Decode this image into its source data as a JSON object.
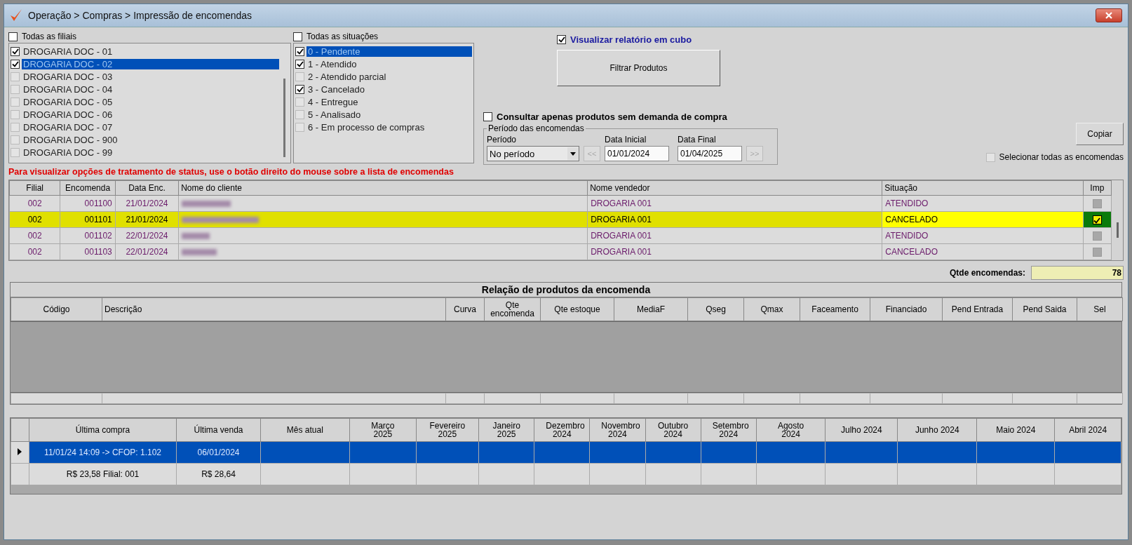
{
  "window": {
    "title": "Operação > Compras > Impressão de encomendas"
  },
  "branches": {
    "all_label": "Todas as filiais",
    "all_checked": false,
    "items": [
      {
        "label": "DROGARIA DOC - 01",
        "checked": true,
        "selected": false
      },
      {
        "label": "DROGARIA DOC - 02",
        "checked": true,
        "selected": true
      },
      {
        "label": "DROGARIA DOC - 03",
        "checked": false,
        "selected": false
      },
      {
        "label": "DROGARIA DOC - 04",
        "checked": false,
        "selected": false
      },
      {
        "label": "DROGARIA DOC - 05",
        "checked": false,
        "selected": false
      },
      {
        "label": "DROGARIA DOC - 06",
        "checked": false,
        "selected": false
      },
      {
        "label": "DROGARIA DOC - 07",
        "checked": false,
        "selected": false
      },
      {
        "label": "DROGARIA DOC - 900",
        "checked": false,
        "selected": false
      },
      {
        "label": "DROGARIA DOC - 99",
        "checked": false,
        "selected": false
      }
    ]
  },
  "situations": {
    "all_label": "Todas as situações",
    "all_checked": false,
    "items": [
      {
        "label": "0 - Pendente",
        "checked": true,
        "selected": true
      },
      {
        "label": "1 - Atendido",
        "checked": true,
        "selected": false
      },
      {
        "label": "2 - Atendido parcial",
        "checked": false,
        "selected": false
      },
      {
        "label": "3 - Cancelado",
        "checked": true,
        "selected": false
      },
      {
        "label": "4 - Entregue",
        "checked": false,
        "selected": false
      },
      {
        "label": "5 - Analisado",
        "checked": false,
        "selected": false
      },
      {
        "label": "6 - Em processo de compras",
        "checked": false,
        "selected": false
      }
    ]
  },
  "cube_option": {
    "label": "Visualizar relatório em cubo",
    "checked": true
  },
  "filter_button": "Filtrar Produtos",
  "no_demand_option": {
    "label": "Consultar apenas produtos sem demanda de compra",
    "checked": false
  },
  "period_group": {
    "title": "Período das encomendas",
    "period_label": "Período",
    "period_value": "No período",
    "prev_button": "<<",
    "start_label": "Data Inicial",
    "start_value": "01/01/2024",
    "end_label": "Data Final",
    "end_value": "01/04/2025",
    "next_button": ">>"
  },
  "copy_button": "Copiar",
  "select_all_orders": {
    "label": "Selecionar todas as encomendas",
    "checked": false
  },
  "status_note": "Para visualizar opções de tratamento de status, use o botão direito do mouse sobre a lista de encomendas",
  "orders_table": {
    "columns": [
      "Filial",
      "Encomenda",
      "Data Enc.",
      "Nome do cliente",
      "Nome vendedor",
      "Situação",
      "Imp"
    ],
    "rows": [
      {
        "branch": "002",
        "order": "001100",
        "date": "21/01/2024",
        "seller": "DROGARIA 001",
        "situation": "ATENDIDO",
        "print": false,
        "selected": false
      },
      {
        "branch": "002",
        "order": "001101",
        "date": "21/01/2024",
        "seller": "DROGARIA 001",
        "situation": "CANCELADO",
        "print": true,
        "selected": true
      },
      {
        "branch": "002",
        "order": "001102",
        "date": "22/01/2024",
        "seller": "DROGARIA 001",
        "situation": "ATENDIDO",
        "print": false,
        "selected": false
      },
      {
        "branch": "002",
        "order": "001103",
        "date": "22/01/2024",
        "seller": "DROGARIA 001",
        "situation": "CANCELADO",
        "print": false,
        "selected": false
      }
    ]
  },
  "order_count": {
    "label": "Qtde encomendas:",
    "value": "78"
  },
  "products_panel": {
    "title": "Relação de produtos da encomenda",
    "columns": [
      "Código",
      "Descrição",
      "Curva",
      "Qte encomenda",
      "Qte estoque",
      "MediaF",
      "Qseg",
      "Qmax",
      "Faceamento",
      "Financiado",
      "Pend Entrada",
      "Pend Saida",
      "Sel"
    ]
  },
  "history_table": {
    "columns": [
      "Última compra",
      "Última venda",
      "Mês atual",
      "Março 2025",
      "Fevereiro 2025",
      "Janeiro 2025",
      "Dezembro 2024",
      "Novembro 2024",
      "Outubro 2024",
      "Setembro 2024",
      "Agosto 2024",
      "Julho 2024",
      "Junho 2024",
      "Maio 2024",
      "Abril 2024"
    ],
    "rows": [
      {
        "cells": [
          "11/01/24 14:09 -> CFOP: 1.102",
          "06/01/2024"
        ],
        "selected": true
      },
      {
        "cells": [
          "R$ 23,58 Filial: 001",
          "R$ 28,64"
        ],
        "selected": false
      }
    ]
  }
}
